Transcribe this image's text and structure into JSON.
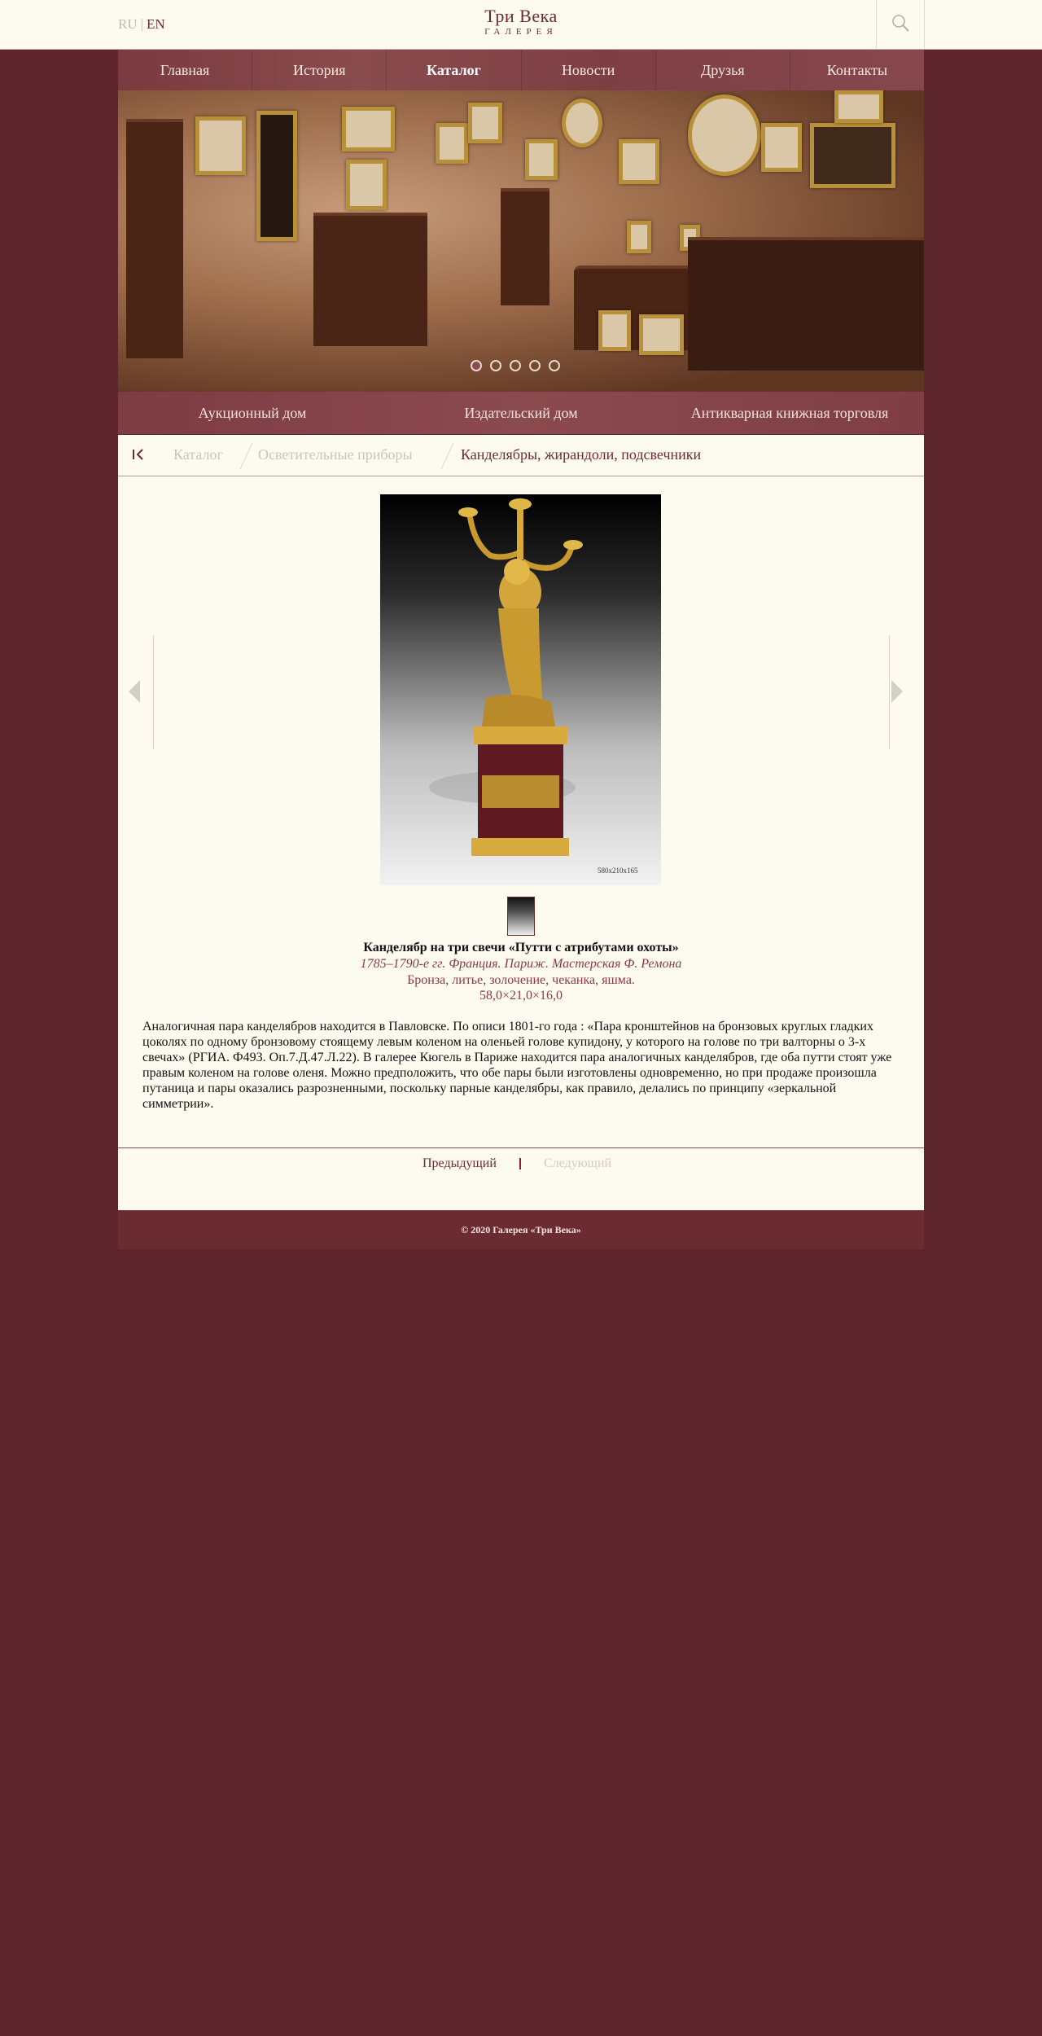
{
  "header": {
    "lang_ru": "RU",
    "lang_sep": "|",
    "lang_en": "EN",
    "logo_line1": "Три Века",
    "logo_line2": "ГАЛЕРЕЯ",
    "search_icon": "search-icon"
  },
  "nav": {
    "items": [
      {
        "label": "Главная"
      },
      {
        "label": "История"
      },
      {
        "label": "Каталог"
      },
      {
        "label": "Новости"
      },
      {
        "label": "Друзья"
      },
      {
        "label": "Контакты"
      }
    ],
    "active_index": 2
  },
  "slider": {
    "dots_count": 5,
    "active_dot": 0
  },
  "subnav": {
    "items": [
      {
        "label": "Аукционный дом"
      },
      {
        "label": "Издательский дом"
      },
      {
        "label": "Антикварная книжная торговля"
      }
    ]
  },
  "breadcrumbs": {
    "home_icon": "back-to-start-icon",
    "items": [
      {
        "label": "Каталог"
      },
      {
        "label": "Осветительные приборы"
      },
      {
        "label": "Канделябры, жирандоли, подсвечники"
      }
    ]
  },
  "item": {
    "image_size_label": "580x210x165",
    "title": "Канделябр на три свечи «Путти с атрибутами охоты»",
    "date_place": "1785–1790-е гг. Франция. Париж. Мастерская Ф. Ремона",
    "material": "Бронза, литье, золочение, чеканка, яшма.",
    "dimensions": "58,0×21,0×16,0",
    "description": "Аналогичная пара канделябров находится в Павловске. По описи 1801-го года : «Пара кронштейнов на бронзовых круглых гладких цоколях по одному бронзовому стоящему левым коленом на оленьей голове купидону, у которого на голове по три валторны о 3-х свечах» (РГИА. Ф493. Оп.7.Д.47.Л.22). В галерее Кюгель в Париже находится пара аналогичных канделябров, где оба путти стоят уже правым коленом на голове оленя. Можно предположить, что обе пары были изготовлены одновременно, но при продаже произошла путаница и пары оказались разрозненными, поскольку парные канделябры, как правило, делались по принципу «зеркальной симметрии»."
  },
  "pager": {
    "prev": "Предыдущий",
    "next": "Следующий"
  },
  "footer": {
    "copyright": "© 2020 Галерея «Три Века»"
  },
  "colors": {
    "background": "#5c262c",
    "accent": "#6b2a33",
    "paper": "#fdfbf0"
  }
}
